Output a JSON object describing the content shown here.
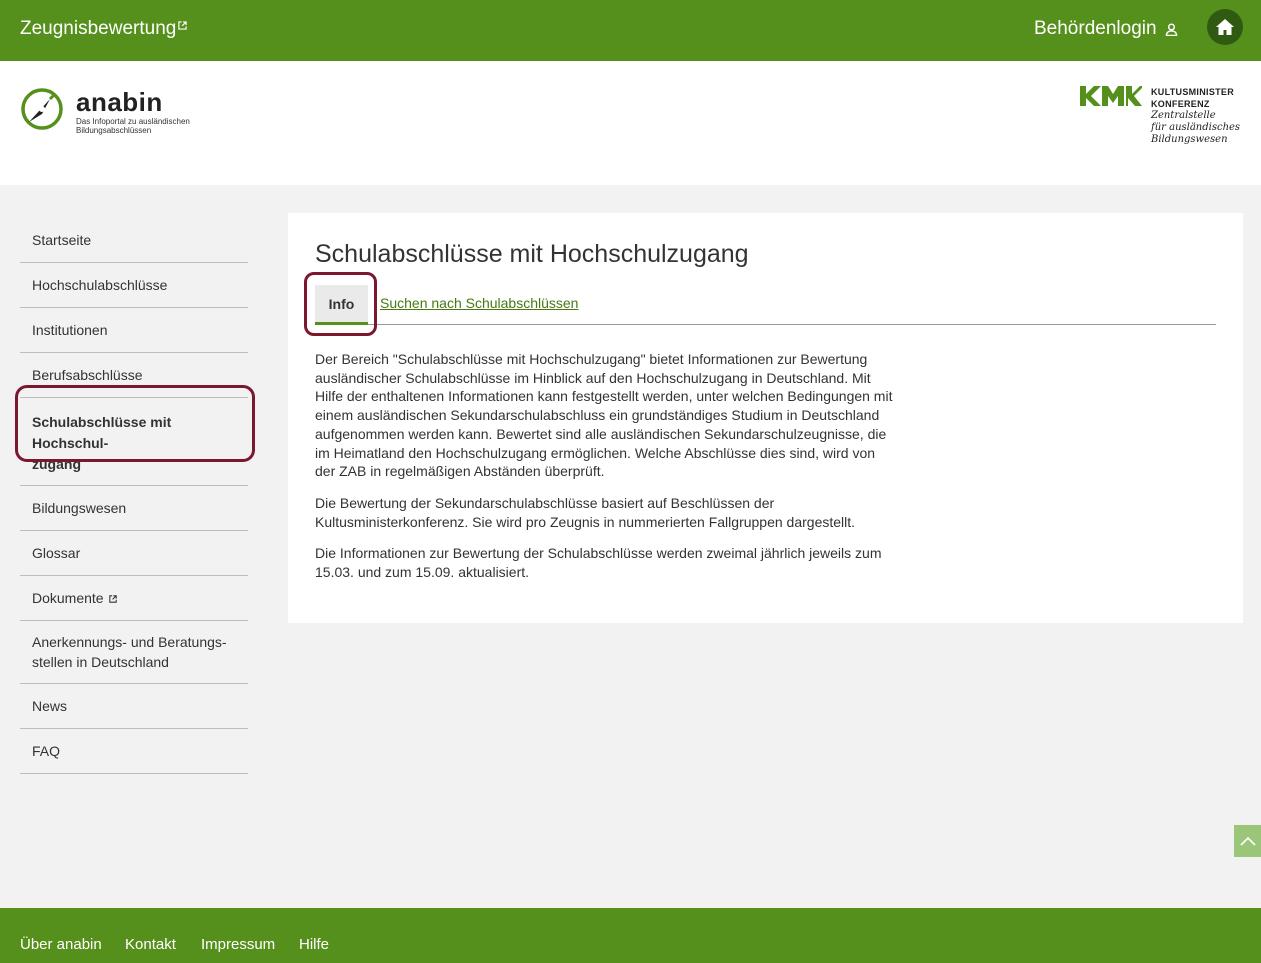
{
  "topbar": {
    "brand": "Zeugnisbewertung",
    "login": "Behördenlogin",
    "home_icon": "home-icon",
    "color": "#56901c"
  },
  "header": {
    "logo_name": "anabin",
    "logo_subtitle": "Das Infoportal zu ausländischen Bildungsabschlüssen",
    "kmk_line1": "KULTUSMINISTER",
    "kmk_line2": "KONFERENZ",
    "kmk_line3": "Zentralstelle",
    "kmk_line4": "für ausländisches",
    "kmk_line5": "Bildungswesen"
  },
  "sidebar": {
    "items": [
      {
        "label": "Startseite"
      },
      {
        "label": "Hochschulabschlüsse"
      },
      {
        "label": "Institutionen"
      },
      {
        "label": "Berufsabschlüsse"
      },
      {
        "label": "Schulabschlüsse mit Hochschul-zugang",
        "line1": "Schulabschlüsse mit Hochschul-",
        "line2": "zugang",
        "active": true
      },
      {
        "label": "Bildungswesen"
      },
      {
        "label": "Glossar"
      },
      {
        "label": "Dokumente",
        "external": true
      },
      {
        "label": "Anerkennungs- und Beratungs-stellen in Deutschland",
        "line1": "Anerkennungs- und Beratungs-",
        "line2": "stellen in Deutschland"
      },
      {
        "label": "News"
      },
      {
        "label": "FAQ"
      }
    ]
  },
  "main": {
    "title": "Schulabschlüsse mit Hochschulzugang",
    "tabs": [
      {
        "label": "Info",
        "active": true
      },
      {
        "label": "Suchen nach Schulabschlüssen"
      }
    ],
    "paragraphs": [
      "Der Bereich \"Schulabschlüsse mit Hochschulzugang\" bietet Informationen zur Bewertung ausländischer Schulabschlüsse im Hinblick auf den Hochschulzugang in Deutschland. Mit Hilfe der enthaltenen Informationen kann festgestellt werden, unter welchen Bedingungen mit einem ausländischen Sekundarschulabschluss ein grundständiges Studium in Deutschland aufgenommen werden kann. Bewertet sind alle ausländischen Sekundarschulzeugnisse, die im Heimatland den Hochschulzugang ermöglichen. Welche Abschlüsse dies sind, wird von der ZAB in regelmäßigen Abständen überprüft.",
      "Die Bewertung der Sekundarschulabschlüsse basiert auf Beschlüssen der Kultusministerkonferenz. Sie wird pro Zeugnis in nummerierten Fallgruppen dargestellt.",
      "Die Informationen zur Bewertung der Schulabschlüsse werden zweimal jährlich jeweils zum 15.03. und zum 15.09. aktualisiert."
    ]
  },
  "footer": {
    "links": [
      "Über anabin",
      "Kontakt",
      "Impressum",
      "Hilfe"
    ]
  },
  "colors": {
    "brand_green": "#56901c",
    "highlight": "#7b1830"
  }
}
